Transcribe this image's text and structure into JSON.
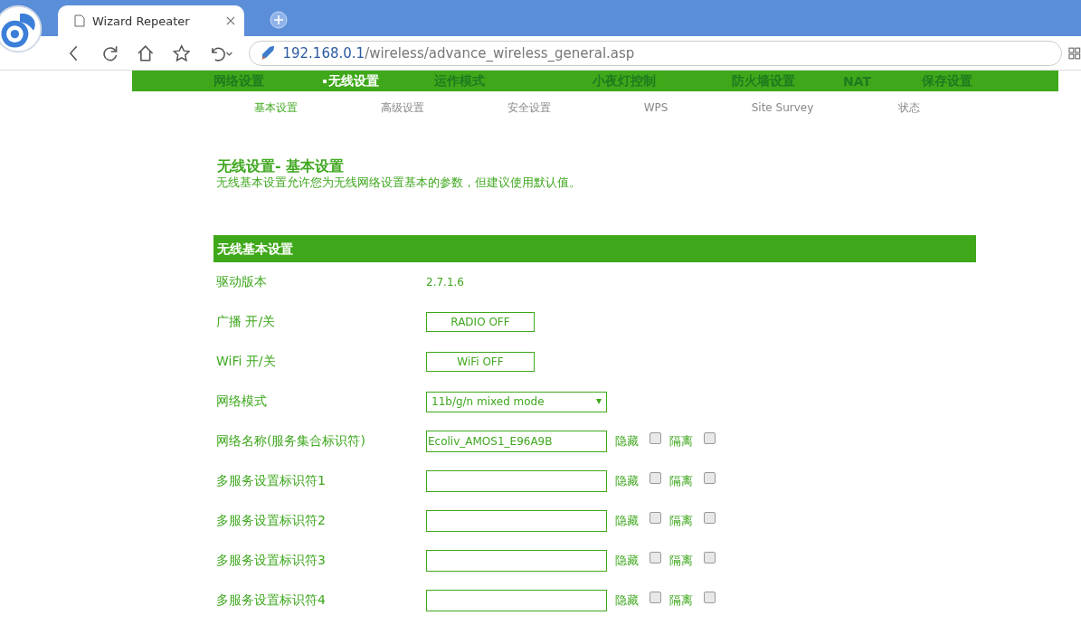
{
  "browser": {
    "tab_title": "Wizard Repeater",
    "url_host": "192.168.0.1",
    "url_path": "/wireless/advance_wireless_general.asp"
  },
  "nav": [
    {
      "label": "网络设置",
      "selected": false
    },
    {
      "label": "无线设置",
      "selected": true
    },
    {
      "label": "运作模式",
      "selected": false
    },
    {
      "label": "小夜灯控制",
      "selected": false
    },
    {
      "label": "防火墙设置",
      "selected": false
    },
    {
      "label": "NAT",
      "selected": false
    },
    {
      "label": "保存设置",
      "selected": false
    }
  ],
  "subnav": [
    {
      "label": "基本设置",
      "selected": true
    },
    {
      "label": "高级设置",
      "selected": false
    },
    {
      "label": "安全设置",
      "selected": false
    },
    {
      "label": "WPS",
      "selected": false
    },
    {
      "label": "Site Survey",
      "selected": false
    },
    {
      "label": "状态",
      "selected": false
    }
  ],
  "page": {
    "title": "无线设置- 基本设置",
    "description": "无线基本设置允许您为无线网络设置基本的参数，但建议使用默认值。"
  },
  "section": {
    "title": "无线基本设置"
  },
  "rows": [
    {
      "kind": "text",
      "label": "驱动版本",
      "value": "2.7.1.6"
    },
    {
      "kind": "button",
      "label": "广播 开/关",
      "value": "RADIO OFF"
    },
    {
      "kind": "button",
      "label": "WiFi 开/关",
      "value": "WiFi OFF"
    },
    {
      "kind": "select",
      "label": "网络模式",
      "value": "11b/g/n mixed mode"
    },
    {
      "kind": "ssid",
      "label": "网络名称(服务集合标识符)",
      "value": "Ecoliv_AMOS1_E96A9B",
      "options": [
        {
          "label": "隐藏",
          "checked": false
        },
        {
          "label": "隔离",
          "checked": false
        }
      ]
    },
    {
      "kind": "ssid",
      "label": "多服务设置标识符1",
      "value": "",
      "options": [
        {
          "label": "隐藏",
          "checked": false
        },
        {
          "label": "隔离",
          "checked": false
        }
      ]
    },
    {
      "kind": "ssid",
      "label": "多服务设置标识符2",
      "value": "",
      "options": [
        {
          "label": "隐藏",
          "checked": false
        },
        {
          "label": "隔离",
          "checked": false
        }
      ]
    },
    {
      "kind": "ssid",
      "label": "多服务设置标识符3",
      "value": "",
      "options": [
        {
          "label": "隐藏",
          "checked": false
        },
        {
          "label": "隔离",
          "checked": false
        }
      ]
    },
    {
      "kind": "ssid",
      "label": "多服务设置标识符4",
      "value": "",
      "options": [
        {
          "label": "隐藏",
          "checked": false
        },
        {
          "label": "隔离",
          "checked": false
        }
      ]
    }
  ]
}
